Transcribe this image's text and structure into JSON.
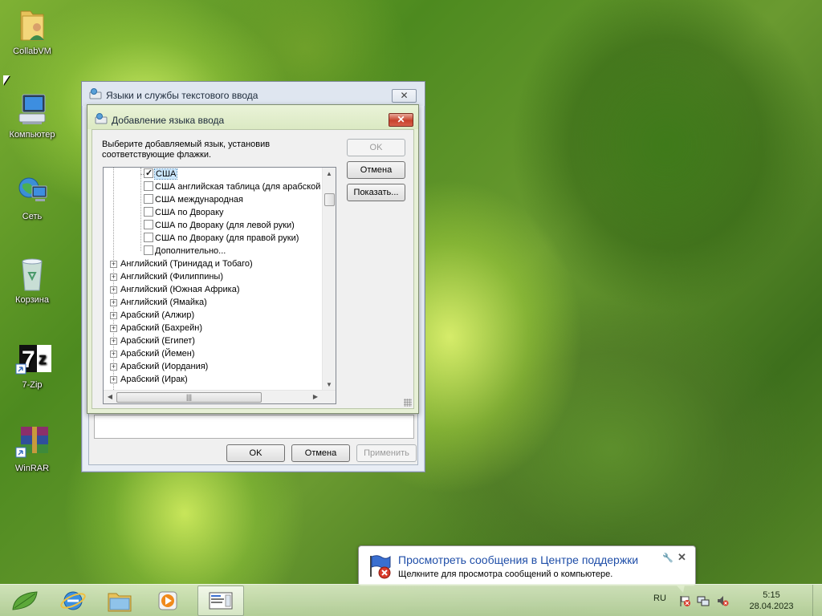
{
  "desktop": {
    "icons": [
      {
        "label": "CollabVM",
        "icon": "folder-user-icon"
      },
      {
        "label": "Компьютер",
        "icon": "computer-icon"
      },
      {
        "label": "Сеть",
        "icon": "network-icon"
      },
      {
        "label": "Корзина",
        "icon": "recycle-bin-icon"
      },
      {
        "label": "7-Zip",
        "icon": "7zip-icon"
      },
      {
        "label": "WinRAR",
        "icon": "winrar-icon"
      }
    ]
  },
  "outer_window": {
    "title": "Языки и службы текстового ввода",
    "ok_label": "OK",
    "cancel_label": "Отмена",
    "apply_label": "Применить"
  },
  "inner_dialog": {
    "title": "Добавление языка ввода",
    "prompt": "Выберите добавляемый язык, установив соответствующие флажки.",
    "ok_label": "OK",
    "cancel_label": "Отмена",
    "show_label": "Показать...",
    "checkbox_items": [
      {
        "label": "США",
        "checked": true,
        "selected": true
      },
      {
        "label": "США английская таблица (для арабской клавиатуры)",
        "checked": false
      },
      {
        "label": "США международная",
        "checked": false
      },
      {
        "label": "США по Двораку",
        "checked": false
      },
      {
        "label": "США по Двораку (для левой руки)",
        "checked": false
      },
      {
        "label": "США по Двораку (для правой руки)",
        "checked": false
      },
      {
        "label": "Дополнительно...",
        "checked": false
      }
    ],
    "language_items": [
      "Английский (Тринидад и Тобаго)",
      "Английский (Филиппины)",
      "Английский (Южная Африка)",
      "Английский (Ямайка)",
      "Арабский (Алжир)",
      "Арабский (Бахрейн)",
      "Арабский (Египет)",
      "Арабский (Йемен)",
      "Арабский (Иордания)",
      "Арабский (Ирак)"
    ]
  },
  "notification": {
    "title": "Просмотреть сообщения в Центре поддержки",
    "text": "Щелкните для просмотра сообщений о компьютере."
  },
  "taskbar": {
    "language": "RU",
    "time": "5:15",
    "date": "28.04.2023",
    "pinned": [
      "start-button",
      "internet-explorer-icon",
      "explorer-folder-icon",
      "media-player-icon",
      "language-settings-window-icon"
    ]
  },
  "colors": {
    "notification_title": "#1f4ea8",
    "close_button": "#c7422c",
    "inner_dialog_frame": "#e7f0d6"
  }
}
